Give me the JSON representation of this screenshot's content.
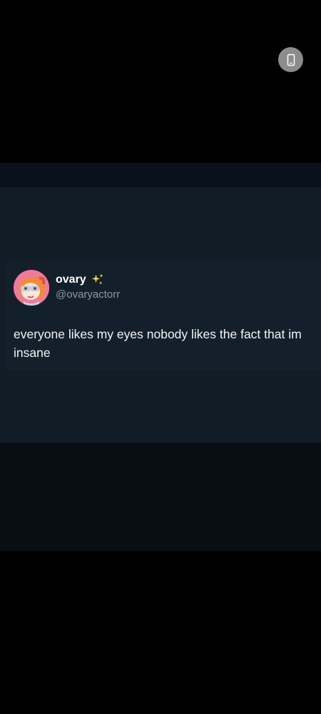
{
  "tweet": {
    "display_name": "ovary",
    "handle": "@ovaryactorr",
    "text": "everyone likes my eyes nobody likes the fact that im insane",
    "avatar_icon": "cartoon-girl-avatar",
    "badge_icon": "sparkles-icon"
  },
  "controls": {
    "rotate_icon": "phone-rotate-icon"
  },
  "colors": {
    "background": "#000000",
    "post_background": "#111c27",
    "name": "#ffffff",
    "handle": "#8b98a5",
    "sparkle": "#f5d547"
  }
}
